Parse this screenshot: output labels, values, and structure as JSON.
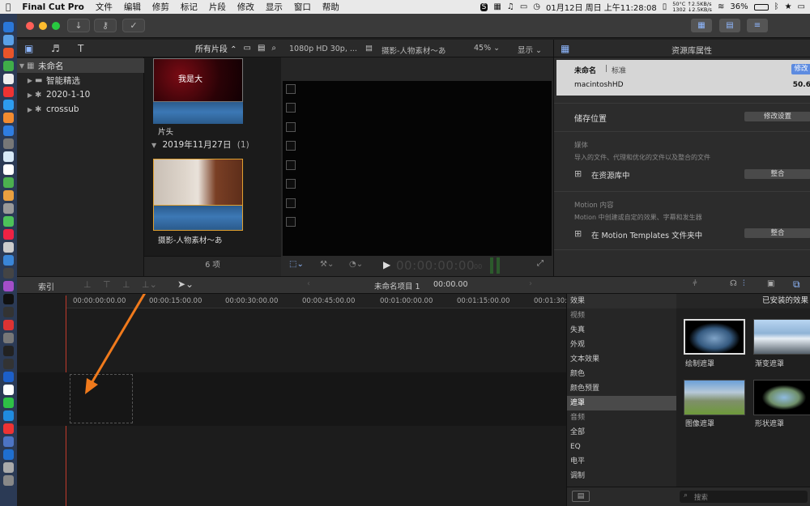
{
  "menubar": {
    "app": "Final Cut Pro",
    "items": [
      "文件",
      "编辑",
      "修剪",
      "标记",
      "片段",
      "修改",
      "显示",
      "窗口",
      "帮助"
    ],
    "status": {
      "temp": "50°C",
      "cpu": "1302",
      "net_up": "↑2.5KB/s",
      "net_down": "↓2.5KB/s",
      "battery": "36%",
      "datetime": "01月12日 周日 上午11:28:08"
    }
  },
  "library": {
    "filter": "所有片段",
    "items": [
      {
        "label": "未命名",
        "icon": "library-icon"
      },
      {
        "label": "智能精选",
        "icon": "folder-icon"
      },
      {
        "label": "2020-1-10",
        "icon": "event-star-icon"
      },
      {
        "label": "crossub",
        "icon": "event-star-icon"
      }
    ]
  },
  "browser": {
    "clip1_label": "片头",
    "clip1_overlay": "我是大",
    "group_title": "2019年11月27日",
    "group_count": "(1)",
    "clip2_label": "摄影-人物素材～あ",
    "count": "6 项"
  },
  "viewer": {
    "format": "1080p HD 30p, ...",
    "clip_name": "摄影-人物素材～あ",
    "zoom": "45%",
    "view_menu": "显示",
    "timecode": "00:00:00:00",
    "timecode_frames": "00"
  },
  "inspector": {
    "title": "资源库属性",
    "lib_name": "未命名",
    "lib_type": "标准",
    "modify_btn": "修改",
    "volume": "macintoshHD",
    "volume_size": "50.6",
    "storage_title": "储存位置",
    "storage_btn": "修改设置",
    "media_title": "媒体",
    "media_desc": "导入的文件、代理和优化的文件以及整合的文件",
    "media_loc": "在资源库中",
    "media_btn": "整合",
    "motion_title": "Motion 内容",
    "motion_desc": "Motion 中创建或自定的效果、字幕和发生器",
    "motion_loc": "在 Motion Templates 文件夹中",
    "motion_btn": "整合"
  },
  "timeline": {
    "index_label": "索引",
    "project_name": "未命名项目 1",
    "project_time": "00:00.00",
    "ticks": [
      "00:00:00:00.00",
      "00:00:15:00.00",
      "00:00:30:00.00",
      "00:00:45:00.00",
      "00:01:00:00.00",
      "00:01:15:00.00",
      "00:01:30:00.00"
    ]
  },
  "effects": {
    "header": "效果",
    "installed": "已安装的效果",
    "categories": [
      "视频",
      "失真",
      "外观",
      "文本效果",
      "颜色",
      "颜色预置",
      "遮罩",
      "音频",
      "全部",
      "EQ",
      "电平",
      "调制"
    ],
    "selected_category": "遮罩",
    "items": [
      "绘制遮罩",
      "渐变遮罩",
      "图像遮罩",
      "形状遮罩"
    ],
    "search_placeholder": "搜索"
  }
}
